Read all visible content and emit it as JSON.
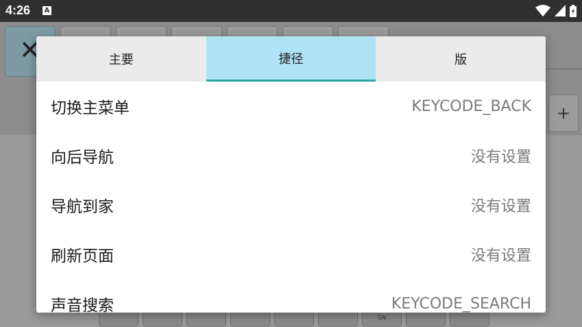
{
  "status_bar": {
    "time": "4:26",
    "notification_icon_letter": "A",
    "icons": [
      "wifi-icon",
      "signal-icon",
      "battery-icon"
    ]
  },
  "background": {
    "plus_label": "+",
    "bottom_key_label": "GN"
  },
  "dialog": {
    "tabs": [
      {
        "label": "主要",
        "active": false
      },
      {
        "label": "捷径",
        "active": true
      },
      {
        "label": "版",
        "active": false
      }
    ],
    "rows": [
      {
        "label": "切换主菜单",
        "value": "KEYCODE_BACK"
      },
      {
        "label": "向后导航",
        "value": "没有设置"
      },
      {
        "label": "导航到家",
        "value": "没有设置"
      },
      {
        "label": "刷新页面",
        "value": "没有设置"
      },
      {
        "label": "声音搜索",
        "value": "KEYCODE_SEARCH"
      }
    ]
  },
  "colors": {
    "active_tab_bg": "#ade3f5",
    "active_tab_indicator": "#2aa7a0",
    "status_bar_bg": "#303030"
  }
}
